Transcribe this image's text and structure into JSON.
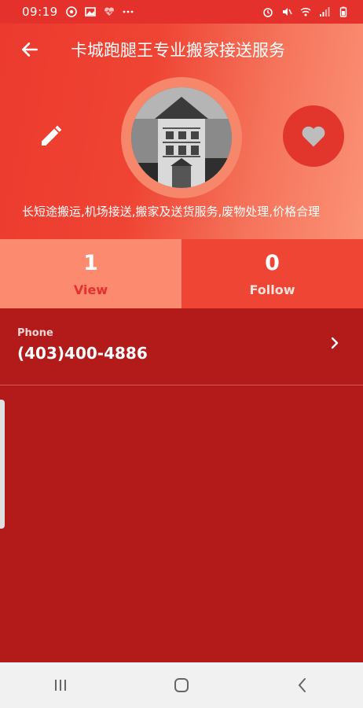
{
  "status_bar": {
    "time": "09:19",
    "left_icons": [
      "messenger-icon",
      "image-icon",
      "heart-monitor-icon",
      "more-dots-icon"
    ],
    "right_icons": [
      "alarm-icon",
      "mute-icon",
      "wifi-icon",
      "signal-icon",
      "battery-icon"
    ]
  },
  "header": {
    "title": "卡城跑腿王专业搬家接送服务"
  },
  "profile": {
    "description": "长短途搬运,机场接送,搬家及送货服务,废物处理,价格合理"
  },
  "stats": {
    "view": {
      "count": "1",
      "label": "View"
    },
    "follow": {
      "count": "0",
      "label": "Follow"
    }
  },
  "contact": {
    "phone_label": "Phone",
    "phone_value": "(403)400-4886"
  },
  "colors": {
    "primary": "#e5312b",
    "background": "#b31b1b",
    "accent_light": "#fb8a6e"
  }
}
